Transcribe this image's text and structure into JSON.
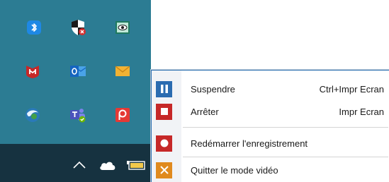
{
  "tray": {
    "icons": [
      {
        "name": "bluetooth-icon",
        "color": "#1e88e5"
      },
      {
        "name": "security-shield-icon",
        "color": "#c62828"
      },
      {
        "name": "eye-monitor-icon",
        "color": "#2e9b7c"
      },
      {
        "name": "mcafee-icon",
        "color": "#c62828"
      },
      {
        "name": "outlook-icon",
        "color": "#1565c0"
      },
      {
        "name": "mail-envelope-icon",
        "color": "#f2b233"
      },
      {
        "name": "browser-globe-icon",
        "color": "#3fa66b"
      },
      {
        "name": "teams-icon",
        "color": "#5b5fc7"
      },
      {
        "name": "recorder-p-icon",
        "color": "#e53935"
      }
    ]
  },
  "taskbar": {
    "icons": [
      "chevron-up-icon",
      "onedrive-cloud-icon",
      "battery-icon"
    ]
  },
  "menu": {
    "items": [
      {
        "label": "Suspendre",
        "shortcut": "Ctrl+Impr Ecran",
        "icon": "pause-icon",
        "icon_color": "#2b6cb0"
      },
      {
        "label": "Arrêter",
        "shortcut": "Impr Ecran",
        "icon": "stop-icon",
        "icon_color": "#c62828"
      },
      {
        "label": "Redémarrer l'enregistrement",
        "shortcut": "",
        "icon": "record-icon",
        "icon_color": "#c62828"
      },
      {
        "label": "Quitter le mode vidéo",
        "shortcut": "",
        "icon": "close-x-icon",
        "icon_color": "#e08a1e"
      }
    ]
  }
}
